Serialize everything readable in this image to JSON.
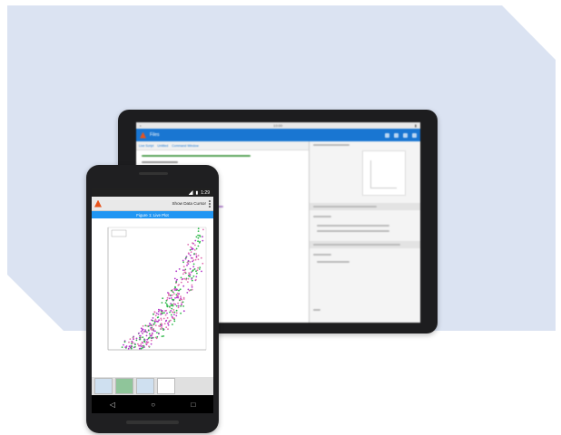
{
  "tablet": {
    "status_time": "10:00",
    "app_name": "Files",
    "tabs": [
      "Live Script",
      "Untitled",
      "Command Window"
    ],
    "editor_comment": "% Visualize data using MATLAB",
    "console_prompt": ">>"
  },
  "phone": {
    "status_time": "1:29",
    "app_title": "Show Data Cursor",
    "figure_title": "Figure 1: Live Plot",
    "nav": {
      "back": "◁",
      "home": "○",
      "recent": "□"
    }
  },
  "colors": {
    "background_shape": "#dbe3f2",
    "accent": "#2196f3",
    "logo": "#e8541c",
    "scatter_purple": "#b338c9",
    "scatter_green": "#2eb84a",
    "scatter_pink": "#e06fb0"
  }
}
